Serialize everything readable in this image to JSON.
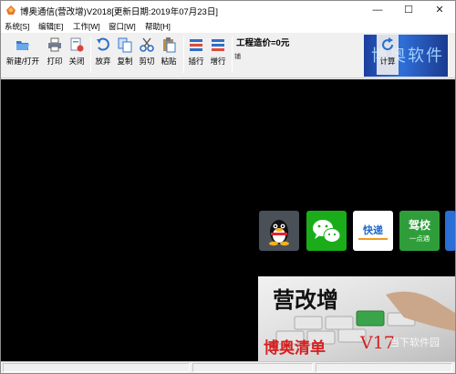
{
  "window": {
    "title": "博奥通信(营改增)V2018[更新日期:2019年07月23日]",
    "controls": {
      "minimize": "—",
      "maximize": "☐",
      "close": "✕"
    }
  },
  "menu": [
    {
      "label": "系统[S]"
    },
    {
      "label": "编辑[E]"
    },
    {
      "label": "工作[W]"
    },
    {
      "label": "窗口[W]"
    },
    {
      "label": "帮助[H]"
    }
  ],
  "toolbar": {
    "buttons": [
      {
        "label": "新建/打开",
        "icon": "folder-open-icon"
      },
      {
        "label": "打印",
        "icon": "printer-icon"
      },
      {
        "label": "关闭",
        "icon": "close-document-icon"
      },
      {
        "label": "放弃",
        "icon": "undo-icon"
      },
      {
        "label": "复制",
        "icon": "copy-icon"
      },
      {
        "label": "剪切",
        "icon": "scissors-icon"
      },
      {
        "label": "粘贴",
        "icon": "paste-icon"
      },
      {
        "label": "插行",
        "icon": "insert-row-icon"
      },
      {
        "label": "增行",
        "icon": "add-row-icon"
      },
      {
        "label": "计算",
        "icon": "refresh-calc-icon"
      }
    ],
    "cost_label": "工程造价=0元",
    "small_mark": "铺",
    "brand_text": "博奥软件"
  },
  "workspace": {
    "tiles": [
      {
        "name": "qq",
        "text": ""
      },
      {
        "name": "wechat",
        "text": ""
      },
      {
        "name": "kuaidi",
        "text": "快递"
      },
      {
        "name": "jiaxiao",
        "text": "驾校",
        "sub": "一点通"
      }
    ],
    "promo": {
      "title": "营改增",
      "subtitle": "博奥清单",
      "version": "V17",
      "watermark": "当下软件园"
    }
  },
  "colors": {
    "workspace_bg": "#000000",
    "promo_red": "#d61f1f",
    "wechat_green": "#1aad19"
  }
}
